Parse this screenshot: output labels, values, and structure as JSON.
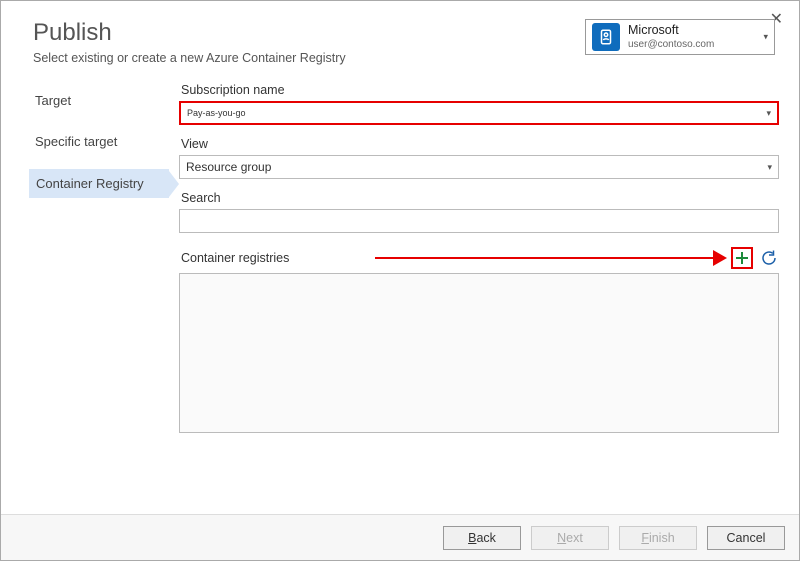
{
  "window": {
    "title": "Publish",
    "subtitle": "Select existing or create a new Azure Container Registry"
  },
  "account": {
    "name": "Microsoft",
    "email": "user@contoso.com"
  },
  "nav": {
    "items": [
      {
        "label": "Target"
      },
      {
        "label": "Specific target"
      },
      {
        "label": "Container Registry"
      }
    ],
    "selected_index": 2
  },
  "form": {
    "subscription_label": "Subscription name",
    "subscription_value": "Pay-as-you-go",
    "view_label": "View",
    "view_value": "Resource group",
    "search_label": "Search",
    "search_value": "",
    "registries_label": "Container registries"
  },
  "footer": {
    "back": "Back",
    "next": "Next",
    "finish": "Finish",
    "cancel": "Cancel"
  }
}
